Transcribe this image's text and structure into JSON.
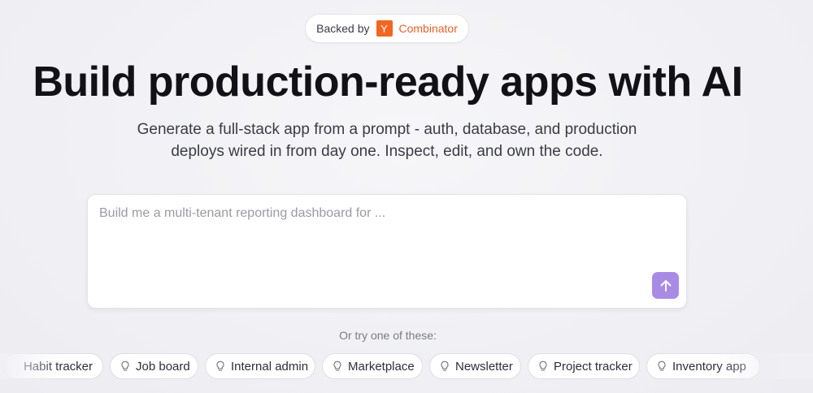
{
  "badge": {
    "prefix": "Backed by",
    "logo_letter": "Y",
    "name": "Combinator",
    "logo_color": "#f26522"
  },
  "hero": {
    "title": "Build production-ready apps with AI",
    "subtitle_line1": "Generate a full-stack app from a prompt - auth, database, and production",
    "subtitle_line2": "deploys wired in from day one. Inspect, edit, and own the code."
  },
  "prompt": {
    "placeholder": "Build me a multi-tenant reporting dashboard for ...",
    "value": "",
    "submit_icon": "arrow-up-icon",
    "accent_color": "#a98be6"
  },
  "suggestions": {
    "label": "Or try one of these:",
    "icon": "lightbulb-icon",
    "items": [
      {
        "label": "Habit tracker"
      },
      {
        "label": "Job board"
      },
      {
        "label": "Internal admin"
      },
      {
        "label": "Marketplace"
      },
      {
        "label": "Newsletter"
      },
      {
        "label": "Project tracker"
      },
      {
        "label": "Inventory app"
      }
    ]
  }
}
